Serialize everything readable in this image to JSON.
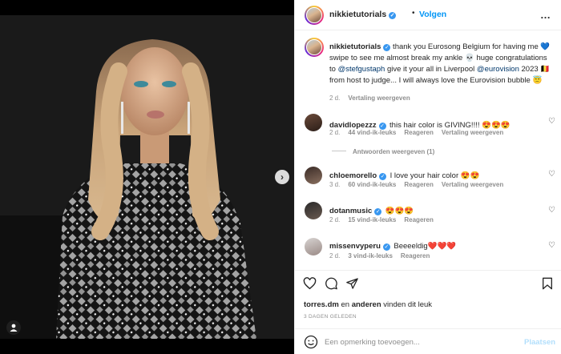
{
  "post": {
    "author": "nikkietutorials",
    "follow_separator": "•",
    "follow_label": "Volgen",
    "more_label": "…"
  },
  "caption": {
    "username": "nikkietutorials",
    "text_1": " thank you Eurosong Belgium for having me ",
    "emoji_heart": "💙",
    "text_2": " swipe to see me almost break my ankle ",
    "emoji_skull": "💀",
    "text_3": " huge congratulations to ",
    "mention_1": "@stefgustaph",
    "text_4": " give it your all in Liverpool ",
    "mention_2": "@eurovision",
    "text_5": " 2023 🇧🇪 from host to judge... I will always love the Eurovision bubble ",
    "emoji_end": "😇",
    "time": "2 d.",
    "translate": "Vertaling weergeven"
  },
  "comments": [
    {
      "username": "davidlopezzz",
      "verified": true,
      "text": "this hair color is GIVING!!!! 😍😍😍",
      "time": "2 d.",
      "likes": "44 vind-ik-leuks",
      "reply": "Reageren",
      "translate": "Vertaling weergeven"
    },
    {
      "username": "chloemorello",
      "verified": true,
      "text": "I love your hair color 😍😍",
      "time": "3 d.",
      "likes": "60 vind-ik-leuks",
      "reply": "Reageren",
      "translate": "Vertaling weergeven"
    },
    {
      "username": "dotanmusic",
      "verified": true,
      "text": "😍😍😍",
      "time": "2 d.",
      "likes": "15 vind-ik-leuks",
      "reply": "Reageren"
    },
    {
      "username": "missenvyperu",
      "verified": true,
      "text": "Beeeeldig❤️❤️❤️",
      "time": "2 d.",
      "likes": "3 vind-ik-leuks",
      "reply": "Reageren"
    }
  ],
  "view_replies": "Antwoorden weergeven (1)",
  "likes_line": {
    "user": "torres.dm",
    "middle": " en ",
    "others": "anderen",
    "suffix": " vinden dit leuk"
  },
  "post_date": "3 DAGEN GELEDEN",
  "add_comment": {
    "placeholder": "Een opmerking toevoegen...",
    "post_label": "Plaatsen"
  },
  "media": {
    "next_arrow": "›"
  },
  "colors": {
    "link_blue": "#0095f6",
    "verified_blue": "#3897f0",
    "muted": "#8e8e8e"
  }
}
